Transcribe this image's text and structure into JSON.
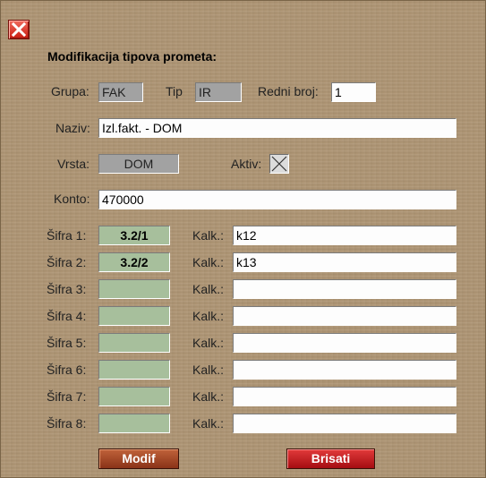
{
  "window": {
    "title": "Modifikacija tipova prometa:"
  },
  "grupa": {
    "label": "Grupa:",
    "value": "FAK"
  },
  "tip": {
    "label": "Tip",
    "value": "IR"
  },
  "redni_broj": {
    "label": "Redni broj:",
    "value": "1"
  },
  "naziv": {
    "label": "Naziv:",
    "value": "Izl.fakt. - DOM"
  },
  "vrsta": {
    "label": "Vrsta:",
    "value": "DOM"
  },
  "aktiv": {
    "label": "Aktiv:",
    "checked": true
  },
  "konto": {
    "label": "Konto:",
    "value": "470000"
  },
  "sifre": [
    {
      "label": "Šifra 1:",
      "value": "3.2/1",
      "kalk_label": "Kalk.:",
      "kalk_value": "k12"
    },
    {
      "label": "Šifra 2:",
      "value": "3.2/2",
      "kalk_label": "Kalk.:",
      "kalk_value": "k13"
    },
    {
      "label": "Šifra 3:",
      "value": "",
      "kalk_label": "Kalk.:",
      "kalk_value": ""
    },
    {
      "label": "Šifra 4:",
      "value": "",
      "kalk_label": "Kalk.:",
      "kalk_value": ""
    },
    {
      "label": "Šifra 5:",
      "value": "",
      "kalk_label": "Kalk.:",
      "kalk_value": ""
    },
    {
      "label": "Šifra 6:",
      "value": "",
      "kalk_label": "Kalk.:",
      "kalk_value": ""
    },
    {
      "label": "Šifra 7:",
      "value": "",
      "kalk_label": "Kalk.:",
      "kalk_value": ""
    },
    {
      "label": "Šifra 8:",
      "value": "",
      "kalk_label": "Kalk.:",
      "kalk_value": ""
    }
  ],
  "buttons": {
    "modif": "Modif",
    "brisati": "Brisati"
  },
  "icons": {
    "close": "close-icon",
    "checkbox": "x-check-icon"
  },
  "colors": {
    "background": "#ae9574",
    "code_field": "#a7bf9c",
    "modif_button": "#a3431f",
    "brisati_button": "#c61f22",
    "close_button": "#d9271b"
  }
}
